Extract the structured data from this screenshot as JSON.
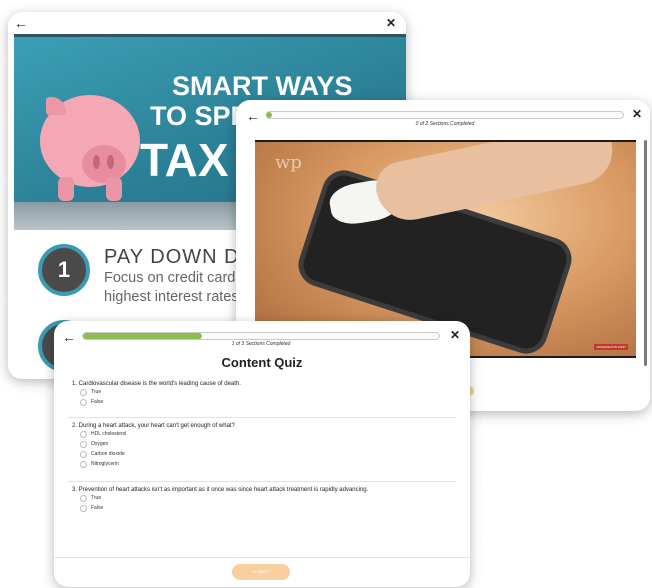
{
  "card1": {
    "back_icon": "←",
    "close_icon": "✕",
    "hero": {
      "line1": "SMART WAYS",
      "line2": "TO SPE",
      "line3": "TAX R"
    },
    "tip": {
      "number": "1",
      "title": "PAY DOWN DEBT",
      "body_line1": "Focus on credit card",
      "body_line2": "highest interest rates"
    }
  },
  "card2": {
    "back_icon": "←",
    "close_icon": "✕",
    "progress_text": "0 of 2 Sections Completed",
    "progress_fraction": 0.0,
    "watermark": "wp",
    "corner_label": "WASHINGTON POST"
  },
  "card3": {
    "back_icon": "←",
    "close_icon": "✕",
    "progress_text": "1 of 3 Sections Completed",
    "progress_fraction": 0.333,
    "title": "Content Quiz",
    "questions": [
      {
        "text": "1. Cardiovascular disease is the world's leading cause of death.",
        "options": [
          "True",
          "False"
        ]
      },
      {
        "text": "2. During a heart attack, your heart can't get enough of what?",
        "options": [
          "HDL cholesterol",
          "Oxygen",
          "Carbon dioxide",
          "Nitroglycerin"
        ]
      },
      {
        "text": "3. Prevention of heart attacks isn't as important as it once was since heart attack treatment is rapidly advancing.",
        "options": [
          "True",
          "False"
        ]
      }
    ],
    "submit_label": "SUBMIT"
  },
  "colors": {
    "accent_green": "#8cbd4e",
    "hero_teal": "#2b8097",
    "submit_orange": "#f9cfa0",
    "tip_ring": "#3a9bb3"
  }
}
